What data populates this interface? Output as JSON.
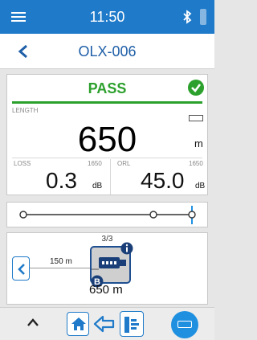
{
  "status_bar": {
    "time": "11:50",
    "bluetooth_icon": "bluetooth-icon",
    "battery_icon": "battery-icon",
    "background_color": "#1f7ac9"
  },
  "header": {
    "title": "OLX-006",
    "back_icon": "chevron-left-icon"
  },
  "result": {
    "status": "PASS",
    "status_color": "#2ca02c",
    "length_label": "LENGTH",
    "length_value": "650",
    "length_unit": "m",
    "loss_label": "LOSS",
    "loss_wavelength": "1650",
    "loss_value": "0.3",
    "loss_unit": "dB",
    "orl_label": "ORL",
    "orl_wavelength": "1650",
    "orl_value": "45.0",
    "orl_unit": "dB"
  },
  "event": {
    "counter": "3/3",
    "span_length": "150 m",
    "position": "650 m",
    "info_icon": "info-icon",
    "b_badge": "B"
  },
  "toolbar": {
    "items": [
      "chevron-up-icon",
      "home-icon",
      "arrow-left-icon",
      "trace-icon",
      "transceiver-icon"
    ]
  }
}
